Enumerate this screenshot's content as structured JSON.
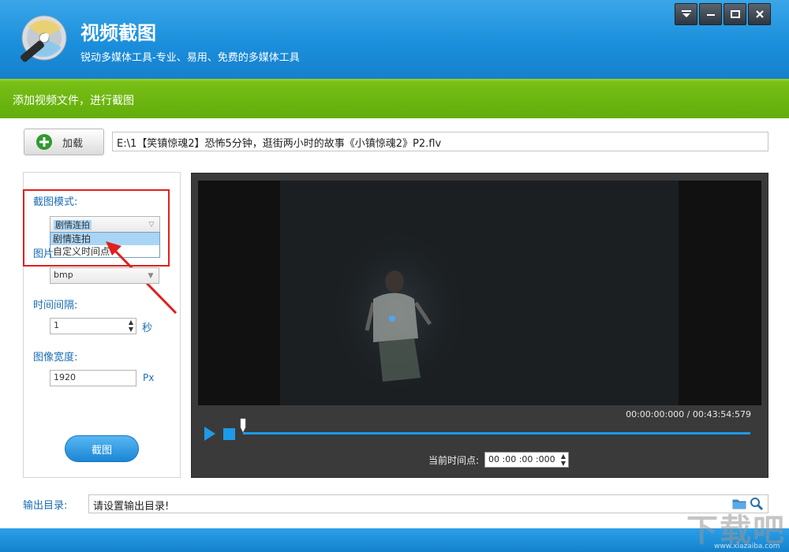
{
  "app": {
    "title": "视频截图",
    "subtitle": "锐动多媒体工具-专业、易用、免费的多媒体工具"
  },
  "step": {
    "text": "添加视频文件，进行截图"
  },
  "file": {
    "load_label": "加载",
    "path": "E:\\1【笑镇惊魂2】恐怖5分钟，逛街两小时的故事《小镇惊魂2》P2.flv"
  },
  "settings": {
    "mode_label": "截图模式:",
    "mode_value": "剧情连拍",
    "mode_options": [
      "剧情连拍",
      "自定义时间点"
    ],
    "format_label_partial": "图片",
    "format_value": "bmp",
    "interval_label": "时间间隔:",
    "interval_value": "1",
    "interval_unit": "秒",
    "width_label": "图像宽度:",
    "width_value": "1920",
    "width_unit": "Px",
    "capture_label": "截图"
  },
  "player": {
    "time_display": "00:00:00:000 / 00:43:54:579",
    "current_label": "当前时间点:",
    "current_value": "00 :00 :00 :000",
    "progress": 0
  },
  "output": {
    "label": "输出目录:",
    "placeholder_value": "请设置输出目录!"
  },
  "watermark": {
    "top": "下载吧",
    "bottom": "www.xiazaiba.com"
  },
  "colors": {
    "accent_blue": "#1b8fdc",
    "green_bar": "#62ad0b",
    "highlight_red": "#e0201d"
  }
}
